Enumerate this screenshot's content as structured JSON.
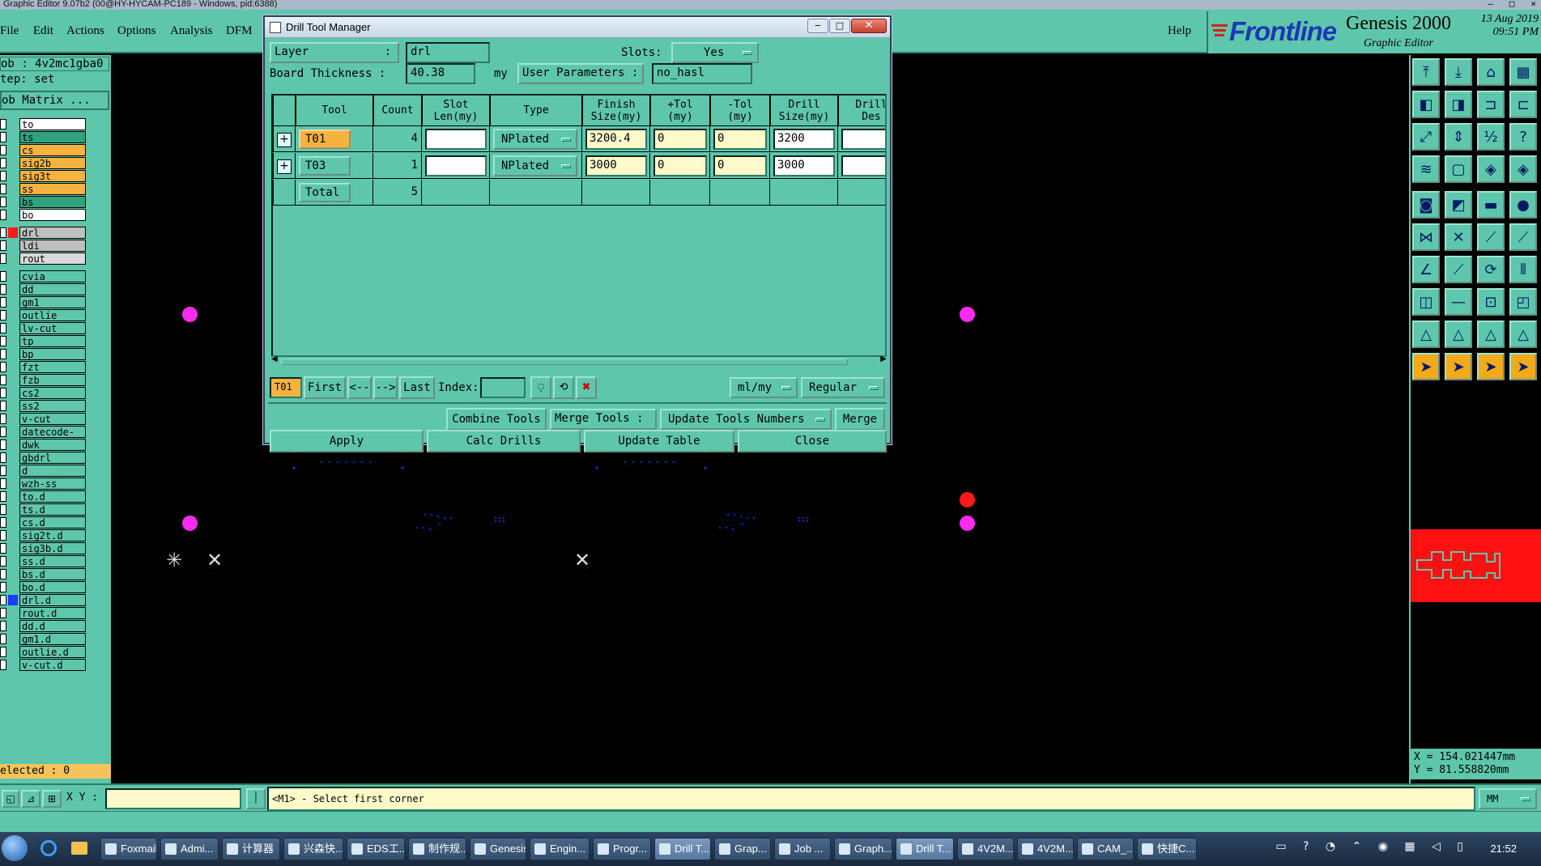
{
  "app": {
    "title": "Graphic Editor 9.07b2 (00@HY-HYCAM-PC189 - Windows, pid:6388)",
    "window_controls": [
      "–",
      "□",
      "×"
    ]
  },
  "menu": {
    "items": [
      "File",
      "Edit",
      "Actions",
      "Options",
      "Analysis",
      "DFM"
    ],
    "help": "Help"
  },
  "brand": {
    "logo": "Frontline",
    "product": "Genesis 2000",
    "subtitle": "Graphic Editor",
    "date": "13 Aug 2019",
    "time": "09:51 PM"
  },
  "left_panel": {
    "job": "ob : 4v2mc1gba0",
    "step": "tep: set",
    "job_matrix": "ob Matrix ...",
    "selected": "elected : 0",
    "layers_group1": [
      {
        "name": "to",
        "color": "#ffffff"
      },
      {
        "name": "ts",
        "color": "#2fa37f"
      },
      {
        "name": "cs",
        "color": "#f5b23e"
      },
      {
        "name": "sig2b",
        "color": "#f5b23e"
      },
      {
        "name": "sig3t",
        "color": "#f5b23e"
      },
      {
        "name": "ss",
        "color": "#f5b23e"
      },
      {
        "name": "bs",
        "color": "#2fa37f"
      },
      {
        "name": "bo",
        "color": "#ffffff"
      }
    ],
    "layers_group2": [
      {
        "name": "drl",
        "color": "#bfbfbf",
        "mark": "#ff1a1a"
      },
      {
        "name": "ldi",
        "color": "#bfbfbf"
      },
      {
        "name": "rout",
        "color": "#d9d9d9"
      }
    ],
    "layers_group3": [
      "cvia",
      "dd",
      "gm1",
      "outlie",
      "lv-cut",
      "tp",
      "bp",
      "fzt",
      "fzb",
      "cs2",
      "ss2",
      "v-cut",
      "datecode-ss",
      "dwk",
      "gbdrl",
      "d",
      "wzh-ss",
      "to.d",
      "ts.d",
      "cs.d",
      "sig2t.d",
      "sig3b.d",
      "ss.d",
      "bs.d",
      "bo.d",
      "drl.d",
      "rout.d",
      "dd.d",
      "gm1.d",
      "outlie.d",
      "v-cut.d"
    ],
    "group3_color": "#5ec7ab",
    "drl_d_mark": "#1a3cff"
  },
  "dialog": {
    "title": "Drill Tool Manager",
    "layer_label": "Layer",
    "layer_colon": ":",
    "layer_value": "drl",
    "slots_label": "Slots:",
    "slots_value": "Yes",
    "board_thickness_label": "Board Thickness :",
    "board_thickness_value": "40.38",
    "board_thickness_unit": "my",
    "user_params_label": "User Parameters :",
    "user_params_value": "no_hasl",
    "columns": [
      "Tool",
      "Count",
      "Slot\nLen(my)",
      "Type",
      "Finish\nSize(my)",
      "+Tol\n(my)",
      "-Tol\n(my)",
      "Drill\nSize(my)",
      "Drill\nDes"
    ],
    "rows": [
      {
        "tool": "T01",
        "count": "4",
        "slot_len": "",
        "type": "NPlated",
        "finish": "3200.4",
        "ptol": "0",
        "ntol": "0",
        "drill": "3200",
        "des": ""
      },
      {
        "tool": "T03",
        "count": "1",
        "slot_len": "",
        "type": "NPlated",
        "finish": "3000",
        "ptol": "0",
        "ntol": "0",
        "drill": "3000",
        "des": ""
      }
    ],
    "total_label": "Total",
    "total_count": "5",
    "current_tool": "T01",
    "nav": {
      "first": "First",
      "prev": "<--",
      "next": "-->",
      "last": "Last",
      "index_label": "Index:",
      "index_value": ""
    },
    "unit_option": "ml/my",
    "mode_option": "Regular",
    "combine_tools": "Combine Tools",
    "merge_tools_label": "Merge Tools :",
    "update_tools_numbers": "Update Tools Numbers",
    "merge": "Merge",
    "apply": "Apply",
    "calc_drills": "Calc Drills",
    "update_table": "Update Table",
    "close": "Close"
  },
  "bottom": {
    "xy_label": "X Y :",
    "xy_value": "",
    "prompt": "<M1> - Select first corner",
    "units": "MM"
  },
  "coords": {
    "x": "X = 154.021447mm",
    "y": "Y = 81.558820mm"
  },
  "taskbar": {
    "items": [
      "Foxmail",
      "Admi...",
      "计算器",
      "兴森快...",
      "EDS工...",
      "制作规...",
      "Genesis",
      "Engin...",
      "Progr...",
      "Drill T...",
      "Grap...",
      "Job ...",
      "Graph...",
      "Drill T...",
      "4V2M...",
      "4V2M...",
      "CAM_...",
      "快捷C..."
    ],
    "clock": "21:52"
  }
}
